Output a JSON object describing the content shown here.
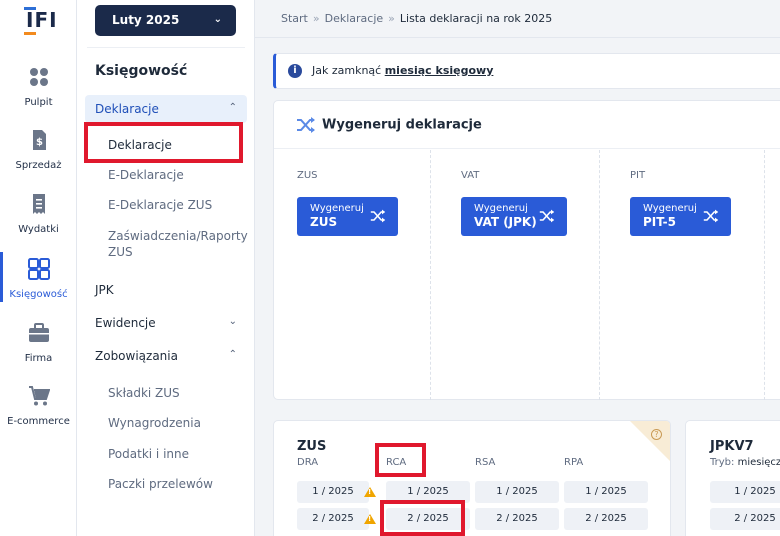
{
  "colors": {
    "accent": "#2a5bd7",
    "navy": "#1b2a4a",
    "highlight": "#e0182d",
    "warning": "#f0a500"
  },
  "logo": {
    "text": "IFI"
  },
  "rail": [
    {
      "label": "Pulpit",
      "icon": "dashboard-icon"
    },
    {
      "label": "Sprzedaż",
      "icon": "invoice-dollar-icon"
    },
    {
      "label": "Wydatki",
      "icon": "receipt-icon"
    },
    {
      "label": "Księgowość",
      "icon": "calculator-grid-icon",
      "active": true
    },
    {
      "label": "Firma",
      "icon": "briefcase-icon"
    },
    {
      "label": "E-commerce",
      "icon": "cart-icon"
    }
  ],
  "period": {
    "label": "Luty 2025"
  },
  "submenu": {
    "title": "Księgowość",
    "deklaracje_group": "Deklaracje",
    "deklaracje_items": [
      "Deklaracje",
      "E-Deklaracje",
      "E-Deklaracje ZUS",
      "Zaświadczenia/Raporty",
      "ZUS"
    ],
    "jpk": "JPK",
    "ewidencje": "Ewidencje",
    "zobowiazania_group": "Zobowiązania",
    "zobowiazania_items": [
      "Składki ZUS",
      "Wynagrodzenia",
      "Podatki i inne",
      "Paczki przelewów"
    ]
  },
  "breadcrumbs": [
    "Start",
    "Deklaracje",
    "Lista deklaracji na rok 2025"
  ],
  "info": {
    "text": "Jak zamknąć ",
    "link": "miesiąc księgowy"
  },
  "generate": {
    "title": "Wygeneruj deklaracje",
    "columns": [
      {
        "label": "ZUS",
        "btn_line1": "Wygeneruj",
        "btn_line2": "ZUS"
      },
      {
        "label": "VAT",
        "btn_line1": "Wygeneruj",
        "btn_line2": "VAT (JPK)"
      },
      {
        "label": "PIT",
        "btn_line1": "Wygeneruj",
        "btn_line2": "PIT-5"
      }
    ]
  },
  "zus_card": {
    "title": "ZUS",
    "help": "?",
    "columns": [
      "DRA",
      "RCA",
      "RSA",
      "RPA"
    ],
    "rows": [
      [
        "1 / 2025",
        "1 / 2025",
        "1 / 2025",
        "1 / 2025"
      ],
      [
        "2 / 2025",
        "2 / 2025",
        "2 / 2025",
        "2 / 2025"
      ]
    ]
  },
  "jpk_card": {
    "title": "JPKV7",
    "tryb_label": "Tryb:",
    "tryb_value": "miesięcz",
    "rows": [
      "1 / 2025",
      "2 / 2025"
    ]
  }
}
